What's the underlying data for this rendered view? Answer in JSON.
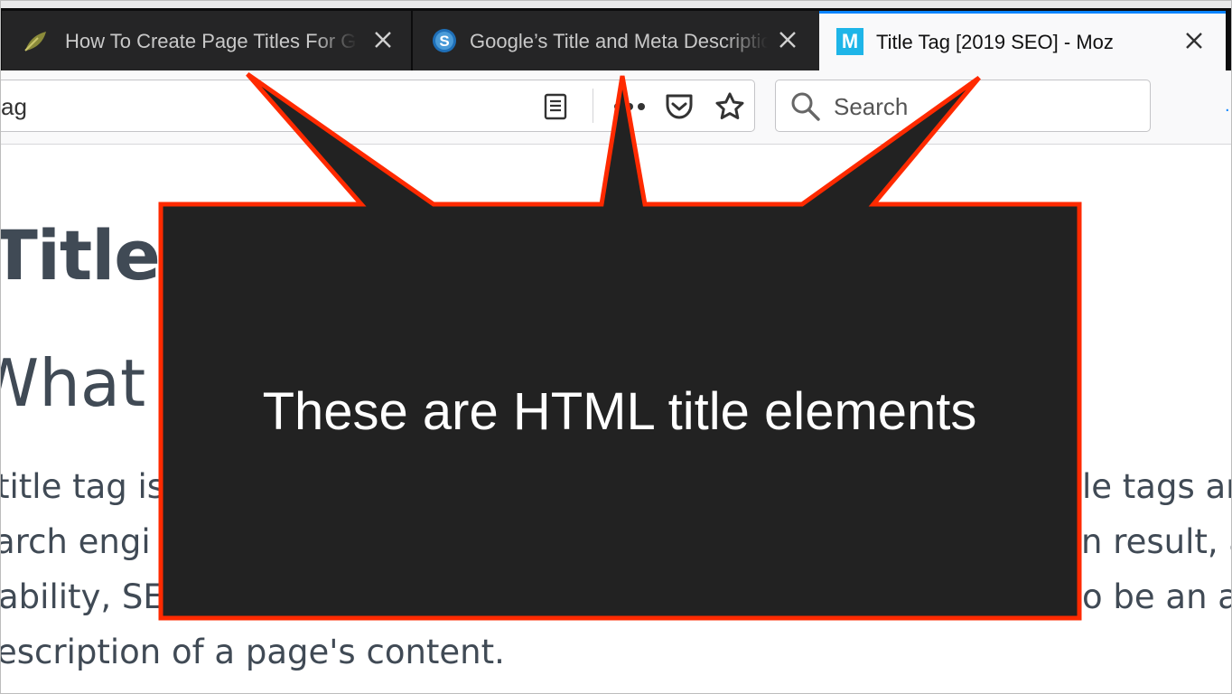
{
  "browser": {
    "tabs": [
      {
        "title": "How To Create Page Titles For Google",
        "state": "inactive",
        "favicon": "seo-leaf-icon"
      },
      {
        "title": "Google’s Title and Meta Descriptions",
        "state": "inactive",
        "favicon": "s-globe-icon"
      },
      {
        "title": "Title Tag [2019 SEO] - Moz",
        "state": "active",
        "favicon": "moz-m-icon",
        "favicon_letter": "M"
      }
    ],
    "url_fragment": "ag",
    "search_placeholder": "Search",
    "accent_color": "#0a84ff"
  },
  "page": {
    "heading": "Title T",
    "subheading": "What",
    "paragraph_left": [
      "title tag is",
      "arch engi",
      "ability, SE",
      "escription of a page's content."
    ],
    "paragraph_right": [
      "le tags are",
      "n result, a",
      "o be an ac"
    ]
  },
  "callout": {
    "text": "These are HTML title elements",
    "fill_color": "#222222",
    "border_color": "#ff2a00"
  }
}
